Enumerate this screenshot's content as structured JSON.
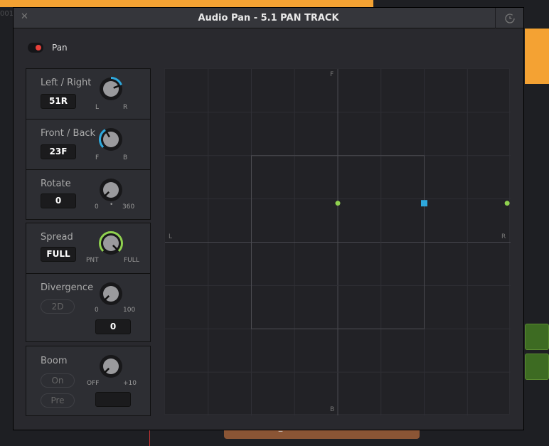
{
  "window": {
    "title": "Audio Pan - 5.1 PAN TRACK",
    "close_icon": "close-icon",
    "reset_icon": "history-reset-icon"
  },
  "pan": {
    "label": "Pan",
    "enabled": true,
    "toggle_color": "#e8403a"
  },
  "controls": {
    "left_right": {
      "label": "Left / Right",
      "value": "51R",
      "min_label": "L",
      "max_label": "R",
      "level": 0.755,
      "arc_color": "#2ea8dc"
    },
    "front_back": {
      "label": "Front / Back",
      "value": "23F",
      "min_label": "F",
      "max_label": "B",
      "level": 0.385,
      "arc_color": "#2ea8dc"
    },
    "rotate": {
      "label": "Rotate",
      "value": "0",
      "min_label": "0",
      "max_label": "360",
      "level": 0
    },
    "spread": {
      "label": "Spread",
      "value": "FULL",
      "min_label": "PNT",
      "max_label": "FULL",
      "level": 1,
      "arc_color": "#8fd14f"
    },
    "divergence": {
      "label": "Divergence",
      "mode_button": "2D",
      "value": "0",
      "min_label": "0",
      "max_label": "100",
      "level": 0
    },
    "boom": {
      "label": "Boom",
      "on_button": "On",
      "pre_button": "Pre",
      "value": "",
      "min_label": "OFF",
      "max_label": "+10",
      "level": 0
    }
  },
  "pan_grid": {
    "top_label": "F",
    "bottom_label": "B",
    "left_label": "L",
    "right_label": "R",
    "points": [
      {
        "type": "speaker",
        "x": 0,
        "y": 0.45,
        "color": "#8fd14f"
      },
      {
        "type": "source",
        "x": 0.5,
        "y": 0.45,
        "color": "#2ea8dc"
      },
      {
        "type": "speaker",
        "x": 0.98,
        "y": 0.45,
        "color": "#8fd14f"
      }
    ]
  },
  "background": {
    "clip_label": "Bucket Hit D_R",
    "timeline_label": "001"
  }
}
